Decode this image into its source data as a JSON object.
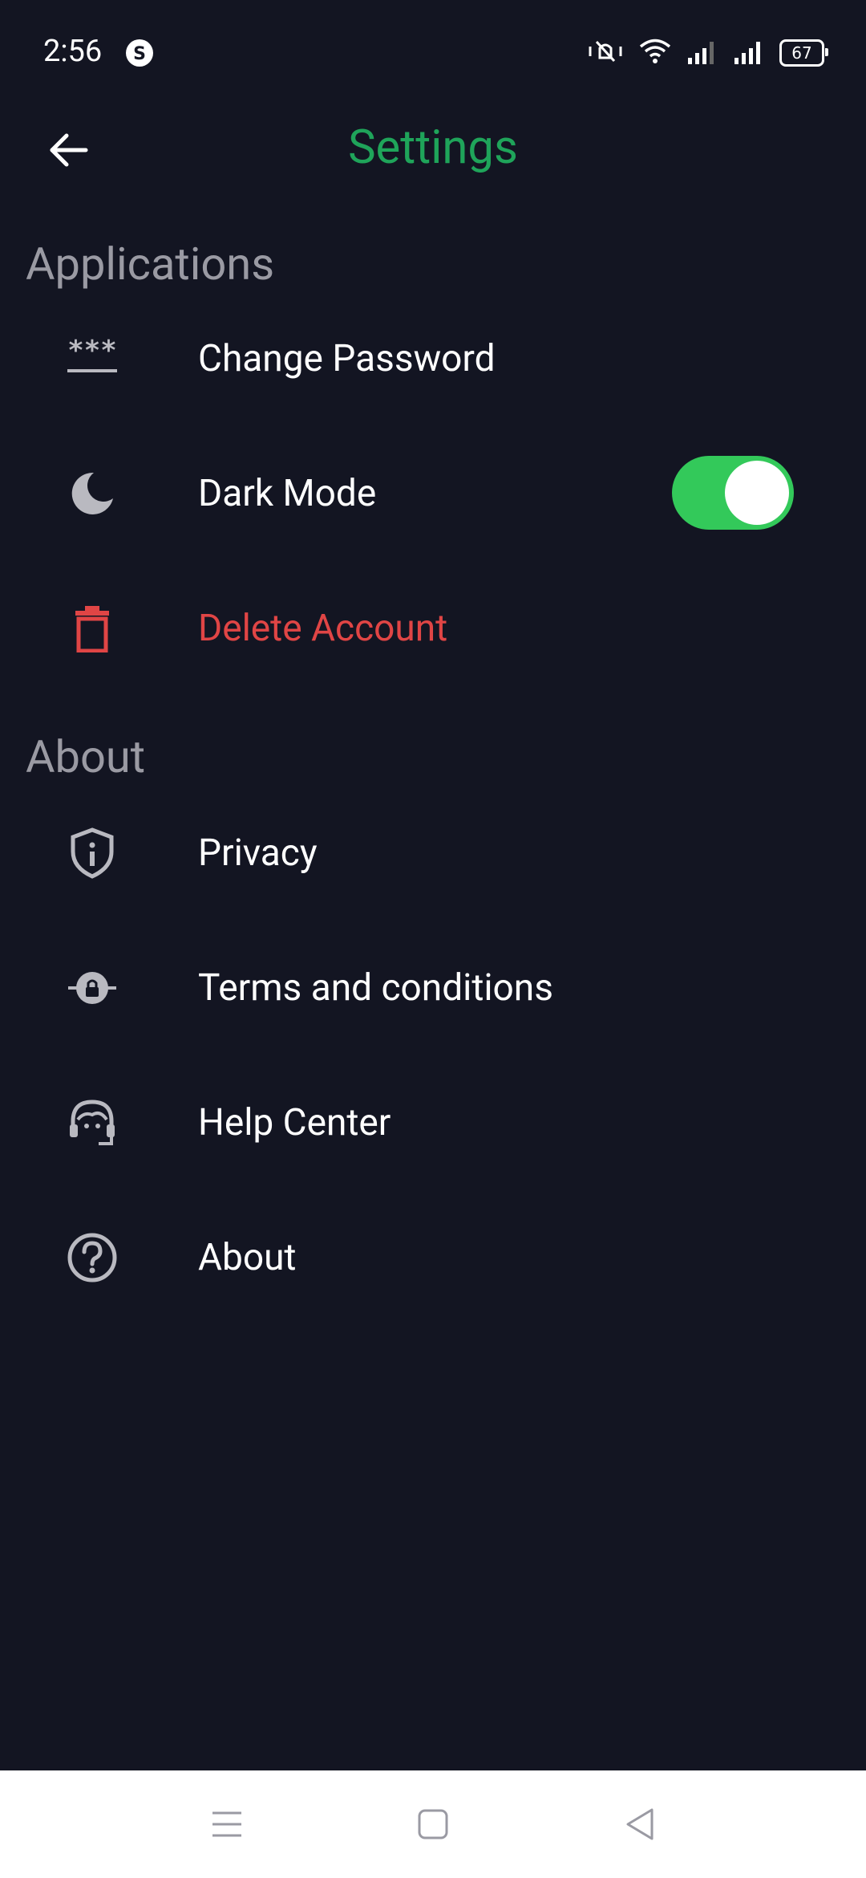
{
  "status_bar": {
    "time": "2:56",
    "battery": "67"
  },
  "header": {
    "title": "Settings",
    "title_color": "#1fa45a"
  },
  "sections": {
    "applications": {
      "header": "Applications",
      "items": [
        {
          "label": "Change Password",
          "icon": "password-icon"
        },
        {
          "label": "Dark Mode",
          "icon": "moon-icon",
          "toggle_on": true
        },
        {
          "label": "Delete Account",
          "icon": "trash-icon",
          "color": "#e04545"
        }
      ]
    },
    "about": {
      "header": "About",
      "items": [
        {
          "label": "Privacy",
          "icon": "shield-info-icon"
        },
        {
          "label": "Terms and conditions",
          "icon": "lock-icon"
        },
        {
          "label": "Help Center",
          "icon": "support-agent-icon"
        },
        {
          "label": "About",
          "icon": "help-circle-icon"
        }
      ]
    }
  },
  "colors": {
    "background": "#131522",
    "toggle_on": "#33c95a",
    "section_header": "#9a9aa3"
  }
}
